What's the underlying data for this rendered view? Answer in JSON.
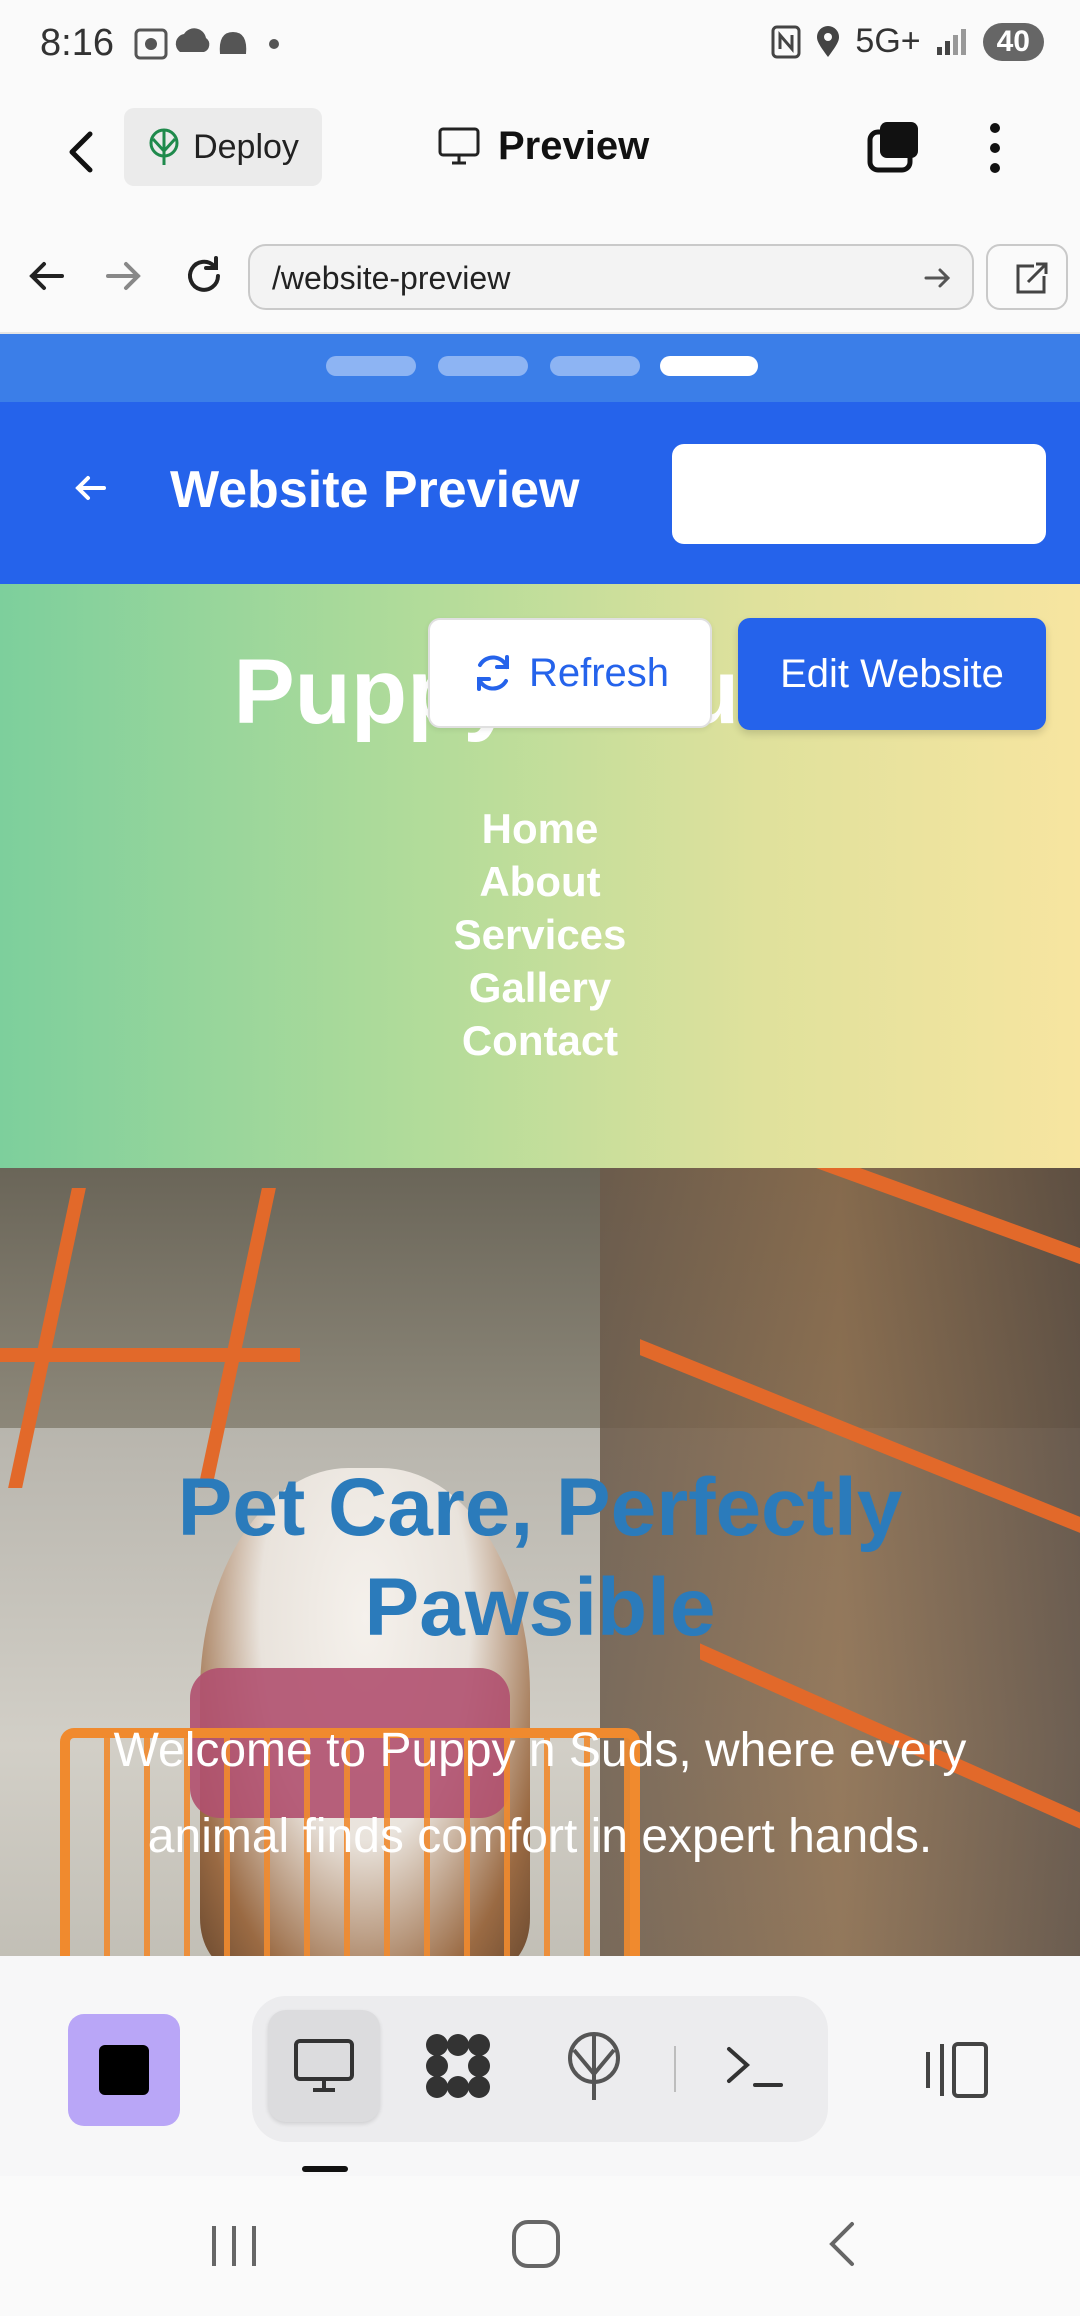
{
  "status_bar": {
    "time": "8:16",
    "network": "5G+",
    "battery": "40"
  },
  "app_bar": {
    "deploy_label": "Deploy",
    "preview_label": "Preview"
  },
  "browser": {
    "url": "/website-preview"
  },
  "wizard": {
    "title": "Website Preview",
    "steps_total": 4,
    "current_step": 4
  },
  "site": {
    "title": "Puppy n Suds",
    "refresh_label": "Refresh",
    "edit_label": "Edit Website",
    "nav": [
      "Home",
      "About",
      "Services",
      "Gallery",
      "Contact"
    ],
    "hero_title": "Pet Care, Perfectly Pawsible",
    "hero_subtitle": "Welcome to Puppy n Suds, where every animal finds comfort in expert hands."
  },
  "toolbar": {
    "active_tool": "preview",
    "tools": [
      "preview-icon",
      "apps-icon",
      "deploy-icon",
      "terminal-icon"
    ]
  },
  "colors": {
    "primary": "#2563eb",
    "progress_strip": "#3b7ee8",
    "stop_button": "#b9a6f7",
    "hero_title": "#2b7bbb"
  }
}
